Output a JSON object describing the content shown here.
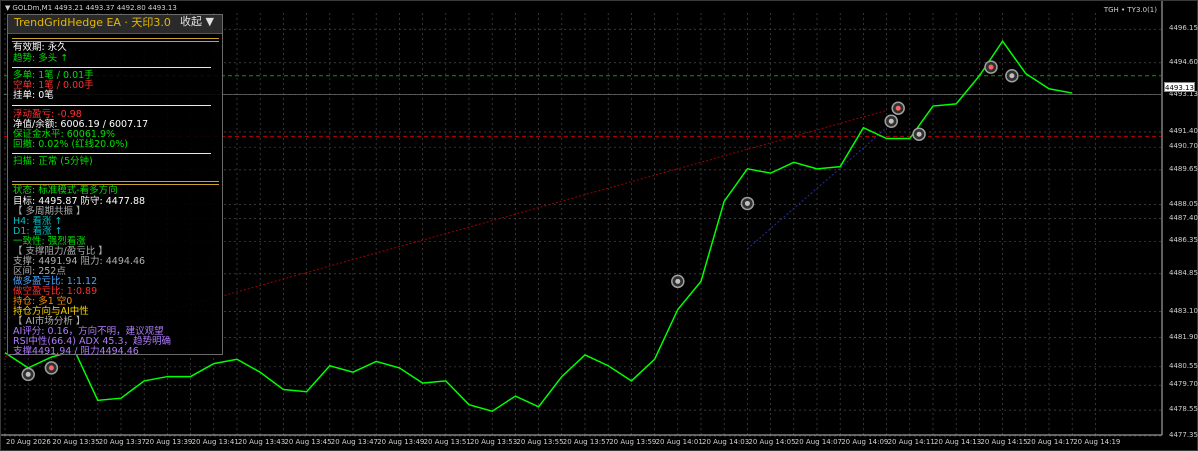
{
  "chart": {
    "symbol_info": "GOLDm,M1  4493.21 4493.37 4492.80 4493.13",
    "indicator_label": "TGH • TY3.0(1)",
    "current_price": "4493.13",
    "colors": {
      "price_line": "#00ff00",
      "grid": "#4a4a4a",
      "background": "#000000",
      "red_level": "#c00000",
      "green_level": "#00a000",
      "trend_line": "#a00000"
    }
  },
  "chart_data": {
    "type": "line",
    "x": [
      "20 Aug 2026 13:33",
      "13:34",
      "13:35",
      "13:36",
      "13:37",
      "13:38",
      "13:39",
      "13:40",
      "13:41",
      "13:42",
      "13:43",
      "13:44",
      "13:45",
      "13:46",
      "13:47",
      "13:48",
      "13:49",
      "13:50",
      "13:51",
      "13:52",
      "13:53",
      "13:54",
      "13:55",
      "13:56",
      "13:57",
      "13:58",
      "13:59",
      "14:00",
      "14:01",
      "14:02",
      "14:03",
      "14:04",
      "14:05",
      "14:06",
      "14:07",
      "14:08",
      "14:09",
      "14:10",
      "14:11",
      "14:12",
      "14:13",
      "14:14",
      "14:15",
      "14:16",
      "14:17",
      "14:18",
      "14:19"
    ],
    "series": [
      {
        "values": [
          4481.2,
          4480.5,
          4481.0,
          4481.3,
          4479.0,
          4479.1,
          4479.9,
          4480.1,
          4480.1,
          4480.7,
          4480.9,
          4480.3,
          4479.5,
          4479.4,
          4480.6,
          4480.3,
          4480.8,
          4480.5,
          4479.8,
          4479.9,
          4478.8,
          4478.5,
          4479.2,
          4478.7,
          4480.1,
          4481.1,
          4480.6,
          4479.9,
          4480.9,
          4483.2,
          4484.5,
          4488.2,
          4489.7,
          4489.5,
          4490.0,
          4489.7,
          4489.8,
          4491.6,
          4491.1,
          4491.1,
          4492.6,
          4492.7,
          4494.0,
          4495.6,
          4494.1,
          4493.4,
          4493.2
        ]
      }
    ],
    "xlabel": "",
    "ylabel": "",
    "ylim": [
      4477.4,
      4496.9
    ],
    "y_ticks": [
      "4496.15",
      "4494.60",
      "4493.13",
      "4491.40",
      "4490.70",
      "4489.65",
      "4488.05",
      "4487.40",
      "4486.35",
      "4484.85",
      "4483.10",
      "4481.90",
      "4480.55",
      "4479.70",
      "4478.55",
      "4477.35"
    ],
    "x_ticks": [
      "20 Aug 2026",
      "20 Aug 13:35",
      "20 Aug 13:37",
      "20 Aug 13:39",
      "20 Aug 13:41",
      "20 Aug 13:43",
      "20 Aug 13:45",
      "20 Aug 13:47",
      "20 Aug 13:49",
      "20 Aug 13:51",
      "20 Aug 13:53",
      "20 Aug 13:55",
      "20 Aug 13:57",
      "20 Aug 13:59",
      "20 Aug 14:01",
      "20 Aug 14:03",
      "20 Aug 14:05",
      "20 Aug 14:07",
      "20 Aug 14:09",
      "20 Aug 14:11",
      "20 Aug 14:13",
      "20 Aug 14:15",
      "20 Aug 14:17",
      "20 Aug 14:19"
    ],
    "levels": {
      "green_dashed": 4494.0,
      "red_dashed": 4491.2
    },
    "grid": true
  },
  "panel": {
    "title": "TrendGridHedge EA · 天印3.0",
    "collapse_label": "收起 ▼",
    "validity": "有效期: 永久",
    "trend": "趋势: 多头 ↑",
    "long_orders": "多单: 1笔 / 0.01手",
    "short_orders": "空单: 1笔 / 0.00手",
    "pending_orders": "挂单: 0笔",
    "float_pnl": "浮动盈亏: -0.98",
    "equity": "净值/余额: 6006.19 / 6007.17",
    "margin_level": "保证金水平: 60061.9%",
    "drawdown": "回撤: 0.02% (红线20.0%)",
    "scan": "扫描: 正常 (5分钟)",
    "status": "状态: 标准模式-看多方向",
    "target": "目标: 4495.87  防守: 4477.88",
    "mtf_header": "【 多周期共振 】",
    "h4": "H4: 看涨 ↑",
    "d1": "D1: 看涨 ↑",
    "consensus": "一致性: 强烈看涨",
    "sr_header": "【 支撑阻力/盈亏比 】",
    "sr": "支撑: 4491.94  阻力: 4494.46",
    "range": "区间: 252点",
    "long_rr": "做多盈亏比: 1:1.12",
    "short_rr": "做空盈亏比: 1:0.89",
    "position_dir": "持仓: 多1 空0",
    "position_ai": "持仓方向与AI中性",
    "ai_header": "【 AI市场分析 】",
    "ai_score": "AI评分: 0.16，方向不明，建议观望",
    "rsi_adx": "RSI中性(66.4)  ADX 45.3，趋势明确",
    "ai_sr": "支撑4491.94 / 阻力4494.46"
  }
}
